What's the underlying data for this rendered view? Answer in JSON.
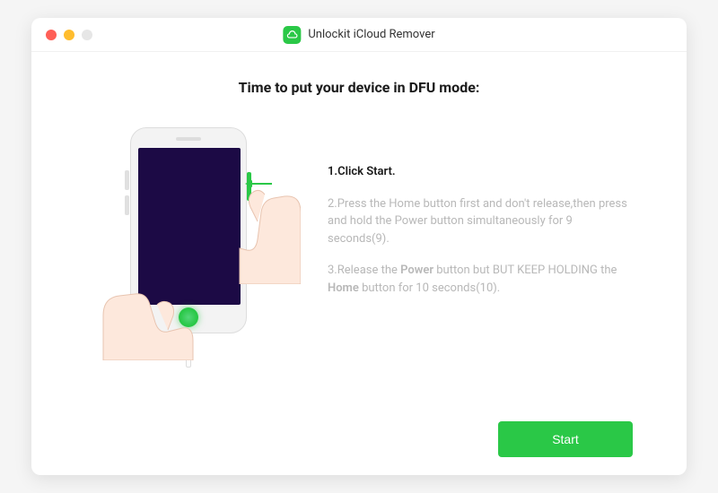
{
  "app": {
    "title": "Unlockit iCloud Remover"
  },
  "page": {
    "title": "Time to put your device in DFU mode:"
  },
  "steps": {
    "step1": "1.Click Start.",
    "step2": "2.Press the Home button first and don't release,then press and hold the Power button simultaneously for 9 seconds(9).",
    "step3_prefix": "3.Release the ",
    "step3_power": "Power",
    "step3_mid": " button but BUT KEEP HOLDING the ",
    "step3_home": "Home",
    "step3_suffix": " button for 10 seconds(10)."
  },
  "buttons": {
    "start": "Start"
  }
}
